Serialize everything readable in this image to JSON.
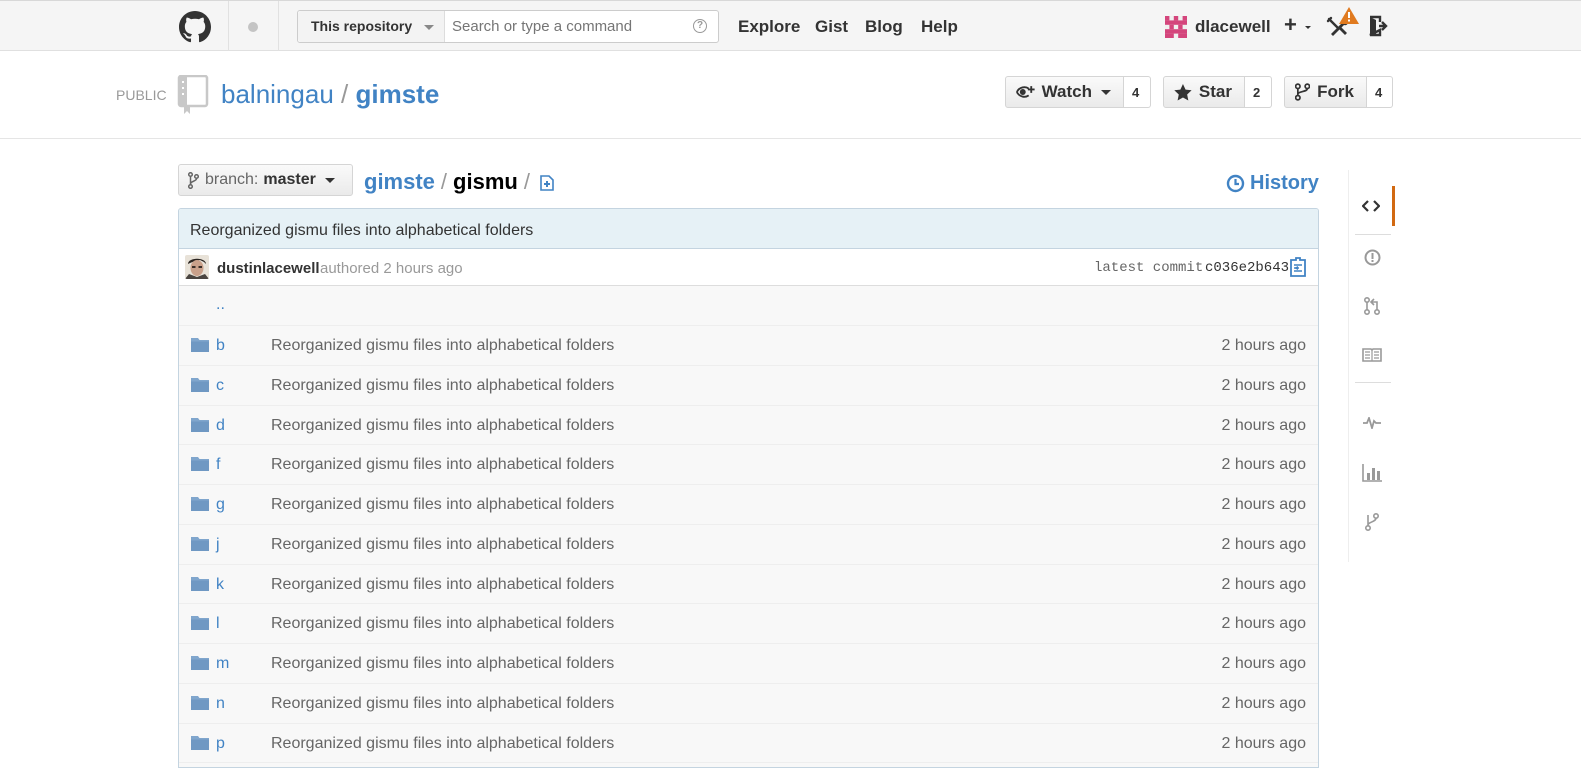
{
  "header": {
    "search_scope": "This repository",
    "search_placeholder": "Search or type a command",
    "nav": [
      "Explore",
      "Gist",
      "Blog",
      "Help"
    ],
    "username": "dlacewell"
  },
  "repo": {
    "visibility": "PUBLIC",
    "owner": "balningau",
    "separator": "/",
    "name": "gimste",
    "watch_label": "Watch",
    "watch_count": "4",
    "star_label": "Star",
    "star_count": "2",
    "fork_label": "Fork",
    "fork_count": "4"
  },
  "filenav": {
    "branch_label": "branch:",
    "branch_value": "master",
    "crumb_root": "gimste",
    "crumb_current": "gismu",
    "separator": "/",
    "history_label": "History"
  },
  "commit": {
    "message": "Reorganized gismu files into alphabetical folders",
    "author": "dustinlacewell",
    "when": "authored 2 hours ago",
    "latest_label": "latest commit",
    "sha": "c036e2b643"
  },
  "files": {
    "up": "..",
    "rows": [
      {
        "name": "b",
        "message": "Reorganized gismu files into alphabetical folders",
        "age": "2 hours ago"
      },
      {
        "name": "c",
        "message": "Reorganized gismu files into alphabetical folders",
        "age": "2 hours ago"
      },
      {
        "name": "d",
        "message": "Reorganized gismu files into alphabetical folders",
        "age": "2 hours ago"
      },
      {
        "name": "f",
        "message": "Reorganized gismu files into alphabetical folders",
        "age": "2 hours ago"
      },
      {
        "name": "g",
        "message": "Reorganized gismu files into alphabetical folders",
        "age": "2 hours ago"
      },
      {
        "name": "j",
        "message": "Reorganized gismu files into alphabetical folders",
        "age": "2 hours ago"
      },
      {
        "name": "k",
        "message": "Reorganized gismu files into alphabetical folders",
        "age": "2 hours ago"
      },
      {
        "name": "l",
        "message": "Reorganized gismu files into alphabetical folders",
        "age": "2 hours ago"
      },
      {
        "name": "m",
        "message": "Reorganized gismu files into alphabetical folders",
        "age": "2 hours ago"
      },
      {
        "name": "n",
        "message": "Reorganized gismu files into alphabetical folders",
        "age": "2 hours ago"
      },
      {
        "name": "p",
        "message": "Reorganized gismu files into alphabetical folders",
        "age": "2 hours ago"
      }
    ]
  },
  "sidebar": {
    "icons": [
      "code-icon",
      "issues-icon",
      "pull-request-icon",
      "wiki-icon",
      "pulse-icon",
      "graphs-icon",
      "network-icon"
    ],
    "active": "code-icon"
  },
  "colors": {
    "link": "#4183c4",
    "accent": "#d26911",
    "commit_bar": "#e6f1f6",
    "warning": "#e07a1f"
  }
}
